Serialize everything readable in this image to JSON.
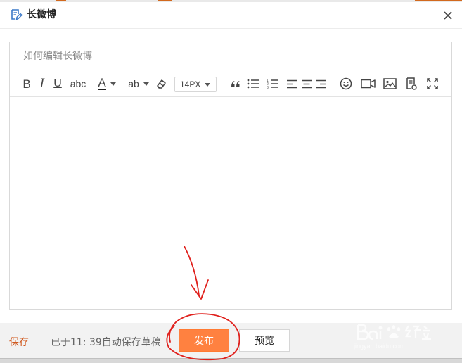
{
  "dialog": {
    "title": "长微博",
    "title_icon": "edit-document-icon",
    "close_icon": "close-icon"
  },
  "editor": {
    "title_placeholder": "如何编辑长微博",
    "title_value": "",
    "toolbar": {
      "bold": "B",
      "italic": "I",
      "underline": "U",
      "strikethrough": "abc",
      "font_color": "A",
      "highlight": "ab",
      "font_size": "14PX"
    },
    "content": ""
  },
  "footer": {
    "save_label": "保存",
    "autosave_text": "已于11: 39自动保存草稿",
    "publish_label": "发布",
    "preview_label": "预览"
  },
  "colors": {
    "accent": "#ff8140",
    "save_link": "#d0591f",
    "annotation_red": "#e0201c",
    "icon_blue": "#3a78c8"
  }
}
